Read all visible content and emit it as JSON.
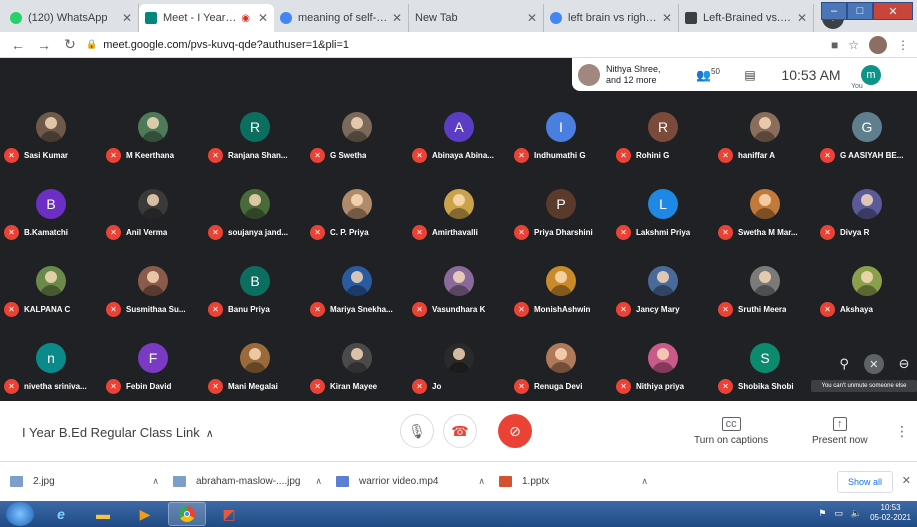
{
  "browser": {
    "tabs": [
      {
        "title": "(120) WhatsApp",
        "color": "#25d366",
        "active": false
      },
      {
        "title": "Meet - I Year B.Ed R",
        "color": "#00897b",
        "active": true
      },
      {
        "title": "meaning of self-actualiz",
        "color": "#4285f4",
        "active": false
      },
      {
        "title": "New Tab",
        "color": "#ffffff",
        "active": false
      },
      {
        "title": "left brain vs right brain",
        "color": "#4285f4",
        "active": false
      },
      {
        "title": "Left-Brained vs. Right-B",
        "color": "#3c4043",
        "active": false
      }
    ],
    "new_tab": "+",
    "url": "meet.google.com/pvs-kuvq-qde?authuser=1&pli=1"
  },
  "meet": {
    "presenter_name": "Nithya Shree,",
    "presenter_more": "and 12 more",
    "participant_count": "50",
    "time": "10:53 AM",
    "you_initial": "m",
    "you_label": "You",
    "participants": [
      {
        "name": "Sasi Kumar",
        "initial": "",
        "color": "#6d5a4b"
      },
      {
        "name": "M Keerthana",
        "initial": "",
        "color": "#4e7a5a"
      },
      {
        "name": "Ranjana Shan...",
        "initial": "R",
        "color": "#0b6e5e"
      },
      {
        "name": "G Swetha",
        "initial": "",
        "color": "#7a6a5a"
      },
      {
        "name": "Abinaya Abina...",
        "initial": "A",
        "color": "#5b3cc4"
      },
      {
        "name": "Indhumathi G",
        "initial": "I",
        "color": "#4a7fe0"
      },
      {
        "name": "Rohini G",
        "initial": "R",
        "color": "#7a4a3a"
      },
      {
        "name": "haniffar A",
        "initial": "",
        "color": "#8a6d5a"
      },
      {
        "name": "G AASIYAH BE...",
        "initial": "G",
        "color": "#5f7f8f"
      },
      {
        "name": "B.Kamatchi",
        "initial": "B",
        "color": "#6b2fc4"
      },
      {
        "name": "Anil Verma",
        "initial": "",
        "color": "#3a3a3a"
      },
      {
        "name": "soujanya jand...",
        "initial": "",
        "color": "#4a6a3a"
      },
      {
        "name": "C. P. Priya",
        "initial": "",
        "color": "#b08a6a"
      },
      {
        "name": "Amirthavalli",
        "initial": "",
        "color": "#c9a24a"
      },
      {
        "name": "Priya Dharshini",
        "initial": "P",
        "color": "#5a3a2a"
      },
      {
        "name": "Lakshmi Priya",
        "initial": "L",
        "color": "#1e88e5"
      },
      {
        "name": "Swetha M Mar...",
        "initial": "",
        "color": "#c27a3a"
      },
      {
        "name": "Divya R",
        "initial": "",
        "color": "#5a5a9a"
      },
      {
        "name": "KALPANA C",
        "initial": "",
        "color": "#6a8a4a"
      },
      {
        "name": "Susmithaa Su...",
        "initial": "",
        "color": "#8a5a4a"
      },
      {
        "name": "Banu Priya",
        "initial": "B",
        "color": "#0b6e5e"
      },
      {
        "name": "Mariya Snekha...",
        "initial": "",
        "color": "#2a5aa0"
      },
      {
        "name": "Vasundhara K",
        "initial": "",
        "color": "#8a6a9a"
      },
      {
        "name": "MonishAshwin",
        "initial": "",
        "color": "#c98a2a"
      },
      {
        "name": "Jancy Mary",
        "initial": "",
        "color": "#4a6a9a"
      },
      {
        "name": "Sruthi Meera",
        "initial": "",
        "color": "#7a7a7a"
      },
      {
        "name": "Akshaya",
        "initial": "",
        "color": "#8aa04a"
      },
      {
        "name": "nivetha sriniva...",
        "initial": "n",
        "color": "#0b8a8a"
      },
      {
        "name": "Febin David",
        "initial": "F",
        "color": "#7a3ac4"
      },
      {
        "name": "Mani Megalai",
        "initial": "",
        "color": "#9a6a3a"
      },
      {
        "name": "Kiran Mayee",
        "initial": "",
        "color": "#4a4a4a"
      },
      {
        "name": "Jo",
        "initial": "",
        "color": "#2a2a2a"
      },
      {
        "name": "Renuga Devi",
        "initial": "",
        "color": "#b07a5a"
      },
      {
        "name": "Nithiya priya",
        "initial": "",
        "color": "#c95a8a"
      },
      {
        "name": "Shobika Shobi",
        "initial": "S",
        "color": "#0b8a6e"
      }
    ],
    "tooltip": "You can't unmute someone else",
    "meeting_name": "I Year B.Ed Regular Class Link",
    "captions_label": "Turn on captions",
    "present_label": "Present now"
  },
  "downloads": {
    "files": [
      {
        "name": "2.jpg",
        "type": "img"
      },
      {
        "name": "abraham-maslow-....jpg",
        "type": "img"
      },
      {
        "name": "warrior video.mp4",
        "type": "vid"
      },
      {
        "name": "1.pptx",
        "type": "ppt"
      }
    ],
    "show_all": "Show all"
  },
  "taskbar": {
    "time": "10:53",
    "date": "05-02-2021"
  },
  "colors": {
    "meet_bg": "#202124",
    "mute_red": "#ea4335",
    "accent_blue": "#1a73e8"
  }
}
